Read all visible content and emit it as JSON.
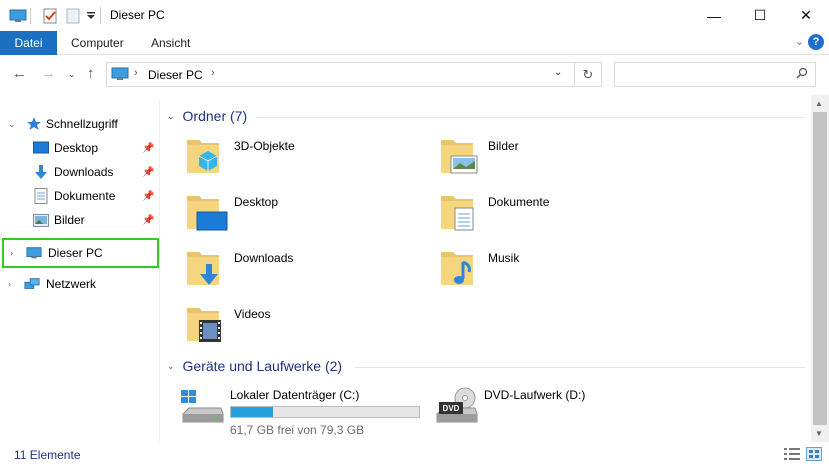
{
  "window": {
    "title": "Dieser PC",
    "minimize_glyph": "—",
    "maximize_glyph": "☐",
    "close_glyph": "✕"
  },
  "ribbon": {
    "tabs": [
      {
        "label": "Datei"
      },
      {
        "label": "Computer"
      },
      {
        "label": "Ansicht"
      }
    ],
    "help_label": "?"
  },
  "navbar": {
    "address_path": "Dieser PC",
    "search_placeholder": ""
  },
  "sidebar": {
    "items": [
      {
        "label": "Schnellzugriff",
        "icon": "star-icon"
      },
      {
        "label": "Desktop",
        "icon": "desktop-icon",
        "pinned": true
      },
      {
        "label": "Downloads",
        "icon": "download-arrow-icon",
        "pinned": true
      },
      {
        "label": "Dokumente",
        "icon": "document-icon",
        "pinned": true
      },
      {
        "label": "Bilder",
        "icon": "pictures-icon",
        "pinned": true
      },
      {
        "label": "Dieser PC",
        "icon": "computer-icon",
        "selected": true
      },
      {
        "label": "Netzwerk",
        "icon": "network-icon"
      }
    ]
  },
  "content": {
    "folders_group": "Ordner (7)",
    "folders": [
      {
        "label": "3D-Objekte",
        "icon": "3d-objects-folder-icon"
      },
      {
        "label": "Bilder",
        "icon": "pictures-folder-icon"
      },
      {
        "label": "Desktop",
        "icon": "desktop-folder-icon"
      },
      {
        "label": "Dokumente",
        "icon": "documents-folder-icon"
      },
      {
        "label": "Downloads",
        "icon": "downloads-folder-icon"
      },
      {
        "label": "Musik",
        "icon": "music-folder-icon"
      },
      {
        "label": "Videos",
        "icon": "videos-folder-icon"
      }
    ],
    "drives_group": "Geräte und Laufwerke (2)",
    "drives": [
      {
        "label": "Lokaler Datenträger (C:)",
        "free_text": "61,7 GB frei von 79,3 GB",
        "used_fraction": 0.222,
        "icon": "hard-drive-icon"
      },
      {
        "label": "DVD-Laufwerk (D:)",
        "icon": "dvd-drive-icon",
        "badge": "DVD"
      }
    ]
  },
  "status": {
    "count": "11 Elemente"
  },
  "colors": {
    "accent": "#1a6fc0",
    "selection_outline": "#34c924",
    "group_header": "#1e3287",
    "drive_fill": "#26a0da"
  }
}
